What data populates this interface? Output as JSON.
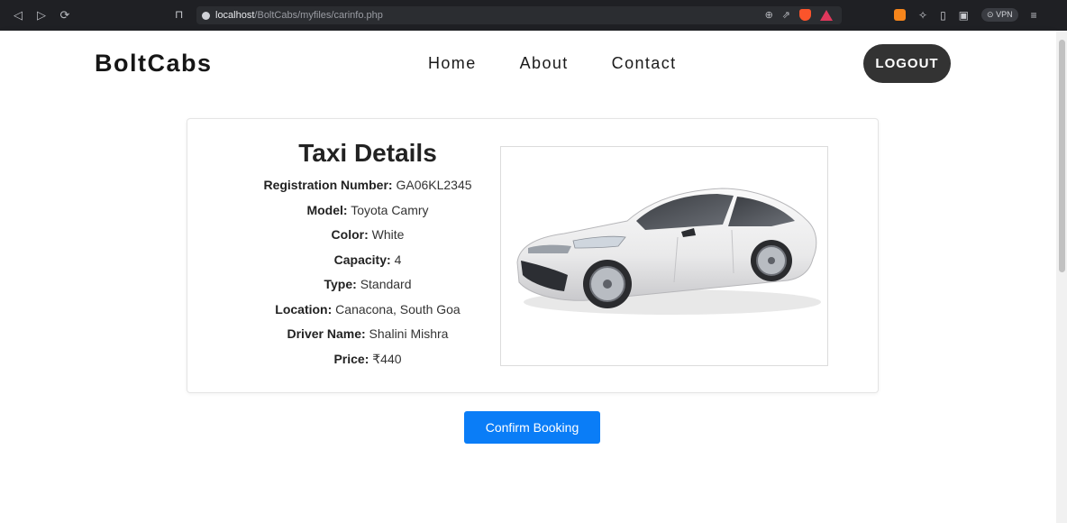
{
  "browser": {
    "url_host": "localhost",
    "url_path": "/BoltCabs/myfiles/carinfo.php",
    "vpn_label": "VPN"
  },
  "site": {
    "logo": "BoltCabs",
    "nav": [
      "Home",
      "About",
      "Contact"
    ],
    "logout_label": "LOGOUT"
  },
  "taxi": {
    "heading": "Taxi Details",
    "fields": [
      {
        "label": "Registration Number:",
        "value": "GA06KL2345"
      },
      {
        "label": "Model:",
        "value": "Toyota Camry"
      },
      {
        "label": "Color:",
        "value": "White"
      },
      {
        "label": "Capacity:",
        "value": "4"
      },
      {
        "label": "Type:",
        "value": "Standard"
      },
      {
        "label": "Location:",
        "value": "Canacona, South Goa"
      },
      {
        "label": "Driver Name:",
        "value": "Shalini Mishra"
      },
      {
        "label": "Price:",
        "value": "₹440"
      }
    ]
  },
  "actions": {
    "confirm_label": "Confirm Booking"
  },
  "colors": {
    "primary_button": "#0a7df7",
    "logout_button": "#333333"
  }
}
